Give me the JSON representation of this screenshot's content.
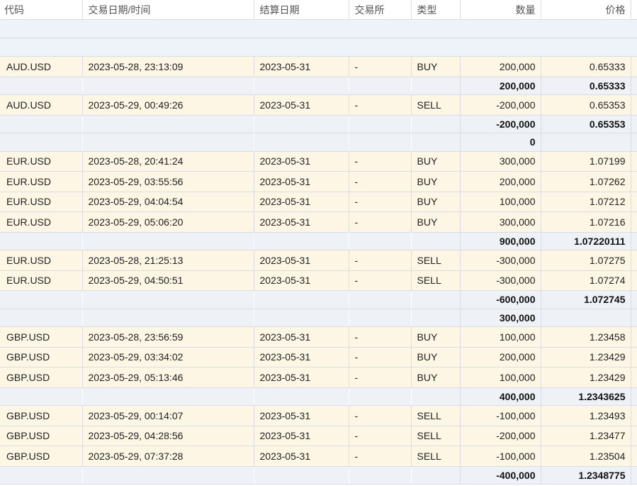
{
  "columns": [
    "代码",
    "交易日期/时间",
    "结算日期",
    "交易所",
    "类型",
    "数量",
    "价格"
  ],
  "rows": [
    {
      "kind": "group"
    },
    {
      "kind": "group"
    },
    {
      "kind": "trade",
      "symbol": "AUD.USD",
      "datetime": "2023-05-28, 23:13:09",
      "settle": "2023-05-31",
      "exchange": "-",
      "type": "BUY",
      "qty": "200,000",
      "price": "0.65333"
    },
    {
      "kind": "sub",
      "qty": "200,000",
      "price": "0.65333"
    },
    {
      "kind": "trade",
      "symbol": "AUD.USD",
      "datetime": "2023-05-29, 00:49:26",
      "settle": "2023-05-31",
      "exchange": "-",
      "type": "SELL",
      "qty": "-200,000",
      "price": "0.65353"
    },
    {
      "kind": "sub",
      "qty": "-200,000",
      "price": "0.65353"
    },
    {
      "kind": "sub",
      "qty": "0",
      "price": ""
    },
    {
      "kind": "trade",
      "symbol": "EUR.USD",
      "datetime": "2023-05-28, 20:41:24",
      "settle": "2023-05-31",
      "exchange": "-",
      "type": "BUY",
      "qty": "300,000",
      "price": "1.07199"
    },
    {
      "kind": "trade",
      "symbol": "EUR.USD",
      "datetime": "2023-05-29, 03:55:56",
      "settle": "2023-05-31",
      "exchange": "-",
      "type": "BUY",
      "qty": "200,000",
      "price": "1.07262"
    },
    {
      "kind": "trade",
      "symbol": "EUR.USD",
      "datetime": "2023-05-29, 04:04:54",
      "settle": "2023-05-31",
      "exchange": "-",
      "type": "BUY",
      "qty": "100,000",
      "price": "1.07212"
    },
    {
      "kind": "trade",
      "symbol": "EUR.USD",
      "datetime": "2023-05-29, 05:06:20",
      "settle": "2023-05-31",
      "exchange": "-",
      "type": "BUY",
      "qty": "300,000",
      "price": "1.07216"
    },
    {
      "kind": "sub",
      "qty": "900,000",
      "price": "1.07220111"
    },
    {
      "kind": "trade",
      "symbol": "EUR.USD",
      "datetime": "2023-05-28, 21:25:13",
      "settle": "2023-05-31",
      "exchange": "-",
      "type": "SELL",
      "qty": "-300,000",
      "price": "1.07275"
    },
    {
      "kind": "trade",
      "symbol": "EUR.USD",
      "datetime": "2023-05-29, 04:50:51",
      "settle": "2023-05-31",
      "exchange": "-",
      "type": "SELL",
      "qty": "-300,000",
      "price": "1.07274"
    },
    {
      "kind": "sub",
      "qty": "-600,000",
      "price": "1.072745"
    },
    {
      "kind": "sub",
      "qty": "300,000",
      "price": ""
    },
    {
      "kind": "trade",
      "symbol": "GBP.USD",
      "datetime": "2023-05-28, 23:56:59",
      "settle": "2023-05-31",
      "exchange": "-",
      "type": "BUY",
      "qty": "100,000",
      "price": "1.23458"
    },
    {
      "kind": "trade",
      "symbol": "GBP.USD",
      "datetime": "2023-05-29, 03:34:02",
      "settle": "2023-05-31",
      "exchange": "-",
      "type": "BUY",
      "qty": "200,000",
      "price": "1.23429"
    },
    {
      "kind": "trade",
      "symbol": "GBP.USD",
      "datetime": "2023-05-29, 05:13:46",
      "settle": "2023-05-31",
      "exchange": "-",
      "type": "BUY",
      "qty": "100,000",
      "price": "1.23429"
    },
    {
      "kind": "sub",
      "qty": "400,000",
      "price": "1.2343625"
    },
    {
      "kind": "trade",
      "symbol": "GBP.USD",
      "datetime": "2023-05-29, 00:14:07",
      "settle": "2023-05-31",
      "exchange": "-",
      "type": "SELL",
      "qty": "-100,000",
      "price": "1.23493"
    },
    {
      "kind": "trade",
      "symbol": "GBP.USD",
      "datetime": "2023-05-29, 04:28:56",
      "settle": "2023-05-31",
      "exchange": "-",
      "type": "SELL",
      "qty": "-200,000",
      "price": "1.23477"
    },
    {
      "kind": "trade",
      "symbol": "GBP.USD",
      "datetime": "2023-05-29, 07:37:28",
      "settle": "2023-05-31",
      "exchange": "-",
      "type": "SELL",
      "qty": "-100,000",
      "price": "1.23504"
    },
    {
      "kind": "sub",
      "qty": "-400,000",
      "price": "1.2348775"
    }
  ],
  "colors": {
    "trade_row": "#fdf6e5",
    "group_row": "#eef3f9",
    "subtotal_row": "#eef2f6",
    "border": "#d9dde3"
  }
}
